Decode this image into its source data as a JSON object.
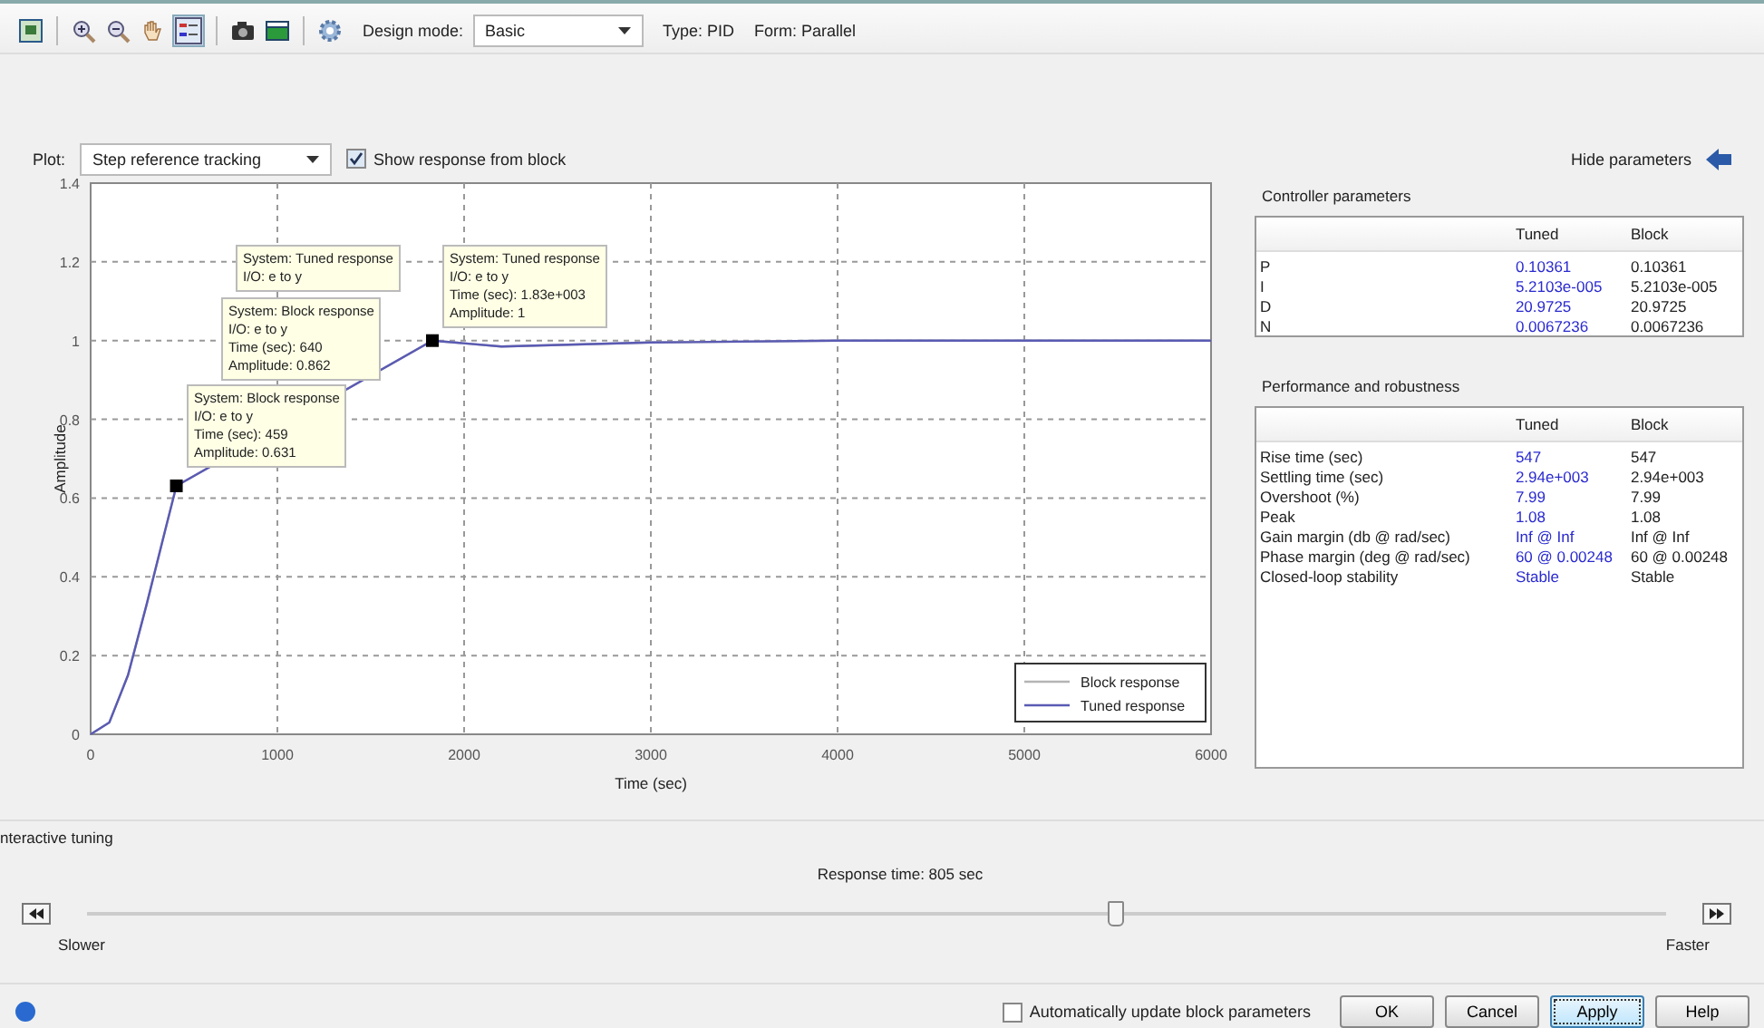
{
  "toolbar": {
    "design_mode_label": "Design mode:",
    "design_mode": "Basic",
    "type": "Type: PID",
    "form": "Form: Parallel"
  },
  "plot_bar": {
    "label": "Plot:",
    "plot": "Step reference tracking",
    "show_block": {
      "label": "Show response from block",
      "checked": true
    },
    "hide_parameters": "Hide parameters"
  },
  "plot": {
    "chart_data": {
      "type": "line",
      "xlabel": "Time (sec)",
      "ylabel": "Amplitude",
      "grid": true,
      "legend": true,
      "x": [
        0,
        100,
        200,
        300,
        400,
        459,
        1830,
        2200,
        2600,
        3000,
        4000,
        5000,
        6000
      ],
      "series": [
        {
          "name": "Block response",
          "color": "#b4b4b4",
          "values": [
            0,
            0.03,
            0.15,
            0.33,
            0.52,
            0.631,
            1.0,
            0.985,
            0.99,
            0.995,
            1,
            1,
            1
          ]
        },
        {
          "name": "Tuned response",
          "color": "#5a5ab4",
          "values": [
            0,
            0.03,
            0.15,
            0.33,
            0.52,
            0.631,
            1.0,
            0.985,
            0.99,
            0.995,
            1,
            1,
            1
          ]
        }
      ],
      "xlim": [
        0,
        6000
      ],
      "ylim": [
        0,
        1.4
      ],
      "xticks": [
        0,
        1000,
        2000,
        3000,
        4000,
        5000,
        6000
      ],
      "yticks": [
        0,
        0.2,
        0.4,
        0.6,
        0.8,
        1,
        1.2,
        1.4
      ]
    },
    "datatips": [
      {
        "lines": [
          "System: Tuned response",
          "I/O: e to y"
        ]
      },
      {
        "lines": [
          "System: Tuned response",
          "I/O: e to y",
          "Time (sec): 1.83e+003",
          "Amplitude: 1"
        ]
      },
      {
        "lines": [
          "System: Block response",
          "I/O: e to y",
          "Time (sec): 640",
          "Amplitude: 0.862"
        ]
      },
      {
        "lines": [
          "System: Block response",
          "I/O: e to y",
          "Time (sec): 459",
          "Amplitude: 0.631"
        ]
      }
    ]
  },
  "controller_parameters": {
    "title": "Controller parameters",
    "columns": [
      "Tuned",
      "Block"
    ],
    "rows": [
      {
        "name": "P",
        "tuned": "0.10361",
        "block": "0.10361"
      },
      {
        "name": "I",
        "tuned": "5.2103e-005",
        "block": "5.2103e-005"
      },
      {
        "name": "D",
        "tuned": "20.9725",
        "block": "20.9725"
      },
      {
        "name": "N",
        "tuned": "0.0067236",
        "block": "0.0067236"
      }
    ]
  },
  "performance": {
    "title": "Performance and robustness",
    "columns": [
      "Tuned",
      "Block"
    ],
    "rows": [
      {
        "name": "Rise time (sec)",
        "tuned": "547",
        "block": "547"
      },
      {
        "name": "Settling time (sec)",
        "tuned": "2.94e+003",
        "block": "2.94e+003"
      },
      {
        "name": "Overshoot (%)",
        "tuned": "7.99",
        "block": "7.99"
      },
      {
        "name": "Peak",
        "tuned": "1.08",
        "block": "1.08"
      },
      {
        "name": "Gain margin (db @ rad/sec)",
        "tuned": "Inf @ Inf",
        "block": "Inf @ Inf"
      },
      {
        "name": "Phase margin (deg @ rad/sec)",
        "tuned": "60 @ 0.00248",
        "block": "60 @ 0.00248"
      },
      {
        "name": "Closed-loop stability",
        "tuned": "Stable",
        "block": "Stable"
      }
    ]
  },
  "tuning": {
    "title": "nteractive tuning",
    "reading": "Response time: 805 sec",
    "level": 0.65,
    "slower": "Slower",
    "faster": "Faster"
  },
  "footer": {
    "auto_update": {
      "label": "Automatically update block parameters",
      "checked": false
    },
    "buttons": [
      {
        "label": "OK",
        "focused": false
      },
      {
        "label": "Cancel",
        "focused": false
      },
      {
        "label": "Apply",
        "focused": true
      },
      {
        "label": "Help",
        "focused": false
      }
    ]
  }
}
